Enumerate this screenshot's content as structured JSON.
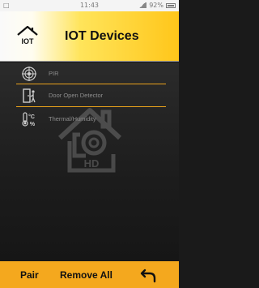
{
  "status_bar": {
    "carrier_glyph": "□",
    "time": "11:43",
    "battery": "92%"
  },
  "header": {
    "icon_label": "IOT",
    "title": "IOT Devices"
  },
  "devices": [
    {
      "label": "PIR",
      "icon": "pir-sensor-icon"
    },
    {
      "label": "Door Open Detector",
      "icon": "door-sensor-icon"
    },
    {
      "label": "Thermal/Humidity",
      "icon": "thermometer-humidity-icon"
    }
  ],
  "watermark": {
    "text": "HD"
  },
  "footer": {
    "pair_label": "Pair",
    "remove_all_label": "Remove All",
    "back_icon": "back-arrow-icon"
  },
  "colors": {
    "accent": "#f4a81e",
    "divider": "#e9a21b",
    "header_gradient_end": "#ffc61a"
  }
}
